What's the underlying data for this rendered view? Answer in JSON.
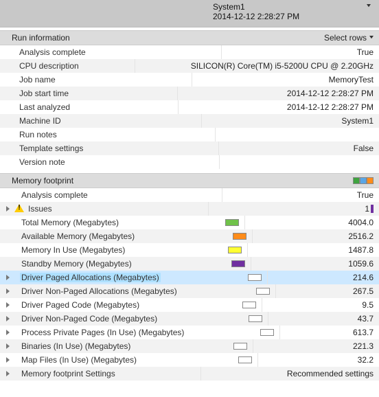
{
  "header": {
    "system": "System1",
    "timestamp": "2014-12-12 2:28:27 PM"
  },
  "runInfo": {
    "title": "Run information",
    "selectRowsLabel": "Select rows",
    "rows": [
      {
        "label": "Analysis complete",
        "value": "True"
      },
      {
        "label": "CPU description",
        "value": "SILICON(R) Core(TM) i5-5200U CPU @ 2.20GHz"
      },
      {
        "label": "Job name",
        "value": "MemoryTest"
      },
      {
        "label": "Job start time",
        "value": "2014-12-12 2:28:27 PM"
      },
      {
        "label": "Last analyzed",
        "value": "2014-12-12 2:28:27 PM"
      },
      {
        "label": "Machine ID",
        "value": "System1"
      },
      {
        "label": "Run notes",
        "value": ""
      },
      {
        "label": "Template settings",
        "value": "False"
      },
      {
        "label": "Version note",
        "value": ""
      }
    ]
  },
  "memFootprint": {
    "title": "Memory footprint",
    "headerSwatches": [
      "#3fa33f",
      "#5aa6e6",
      "#ff8c1a"
    ],
    "rows": [
      {
        "label": "Analysis complete",
        "value": "True",
        "expandable": false
      },
      {
        "label": "Issues",
        "value": "1",
        "expandable": true,
        "warning": true,
        "rightColor": "#7030a0"
      },
      {
        "label": "Total Memory (Megabytes)",
        "value": "4004.0",
        "swatch": "#70c24a"
      },
      {
        "label": "Available Memory (Megabytes)",
        "value": "2516.2",
        "swatch": "#ff8c1a"
      },
      {
        "label": "Memory In Use (Megabytes)",
        "value": "1487.8",
        "swatch": "#ffff33"
      },
      {
        "label": "Standby Memory (Megabytes)",
        "value": "1059.6",
        "swatch": "#7030a0"
      },
      {
        "label": "Driver Paged Allocations (Megabytes)",
        "value": "214.6",
        "expandable": true,
        "swatch": "empty",
        "selected": true
      },
      {
        "label": "Driver Non-Paged Allocations (Megabytes)",
        "value": "267.5",
        "expandable": true,
        "swatch": "empty"
      },
      {
        "label": "Driver Paged Code (Megabytes)",
        "value": "9.5",
        "expandable": true,
        "swatch": "empty"
      },
      {
        "label": "Driver Non-Paged Code (Megabytes)",
        "value": "43.7",
        "expandable": true,
        "swatch": "empty"
      },
      {
        "label": "Process Private Pages (In Use) (Megabytes)",
        "value": "613.7",
        "expandable": true,
        "swatch": "empty"
      },
      {
        "label": "Binaries (In Use) (Megabytes)",
        "value": "221.3",
        "expandable": true,
        "swatch": "empty"
      },
      {
        "label": "Map Files (In Use) (Megabytes)",
        "value": "32.2",
        "expandable": true,
        "swatch": "empty"
      },
      {
        "label": "Memory footprint Settings",
        "value": "Recommended settings",
        "expandable": true
      }
    ]
  }
}
